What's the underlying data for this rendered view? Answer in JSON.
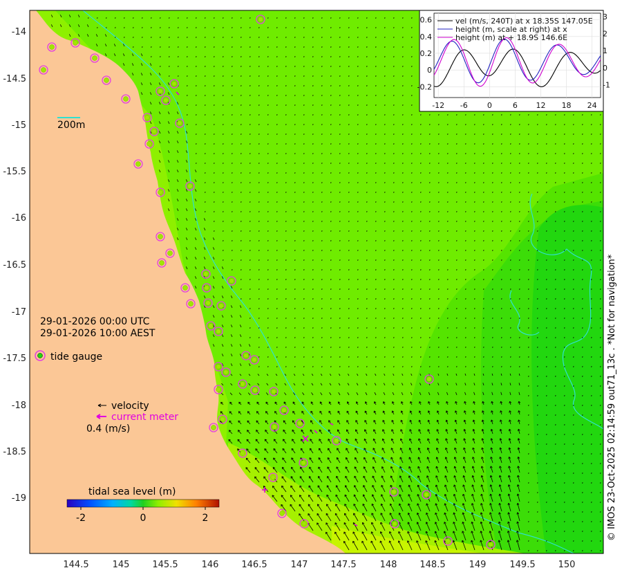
{
  "map": {
    "lon_range": [
      144.0,
      150.4
    ],
    "lat_range": [
      -19.5,
      -13.8
    ],
    "x_ticks": [
      "144.5",
      "145",
      "145.5",
      "146",
      "146.5",
      "147",
      "147.5",
      "148",
      "148.5",
      "149",
      "149.5",
      "150"
    ],
    "y_ticks": [
      "-14",
      "-14.5",
      "-15",
      "-15.5",
      "-16",
      "-16.5",
      "-17",
      "-17.5",
      "-18",
      "-18.5",
      "-19"
    ],
    "scale_bar_label": "200m",
    "date_utc": "29-01-2026 00:00 UTC",
    "date_local": "29-01-2026 10:00 AEST",
    "legend": {
      "tide_gauge": "tide gauge",
      "velocity": "velocity",
      "current_meter": "current meter",
      "velocity_scale": "0.4 (m/s)"
    },
    "colorbar": {
      "title": "tidal sea level (m)",
      "ticks": [
        "-2",
        "0",
        "2"
      ],
      "range": [
        -2.5,
        2.5
      ]
    },
    "credit": "© IMOS 23-Oct-2025 02:14:59 out71_13c . *Not for navigation*",
    "colors": {
      "land": "#fbc796",
      "sea_high": "#6fec00",
      "sea_mid": "#55e400",
      "sea_low": "#22d70f",
      "contour": "#2fe0d0",
      "gauge_ring": "#e23fe0",
      "current_meter": "#e000e0"
    }
  },
  "inset": {
    "legend": [
      "vel (m/s, 240T) at x 18.35S 147.05E",
      "height (m, scale at right) at x",
      "height (m) at + 18.9S 146.6E"
    ],
    "x_ticks": [
      "-12",
      "-6",
      "0",
      "6",
      "12",
      "18",
      "24"
    ],
    "y_left_ticks": [
      "0.6",
      "0.4",
      "0.2",
      "0",
      "-0.2"
    ],
    "y_right_ticks": [
      "3",
      "2",
      "1",
      "0",
      "-1"
    ]
  }
}
